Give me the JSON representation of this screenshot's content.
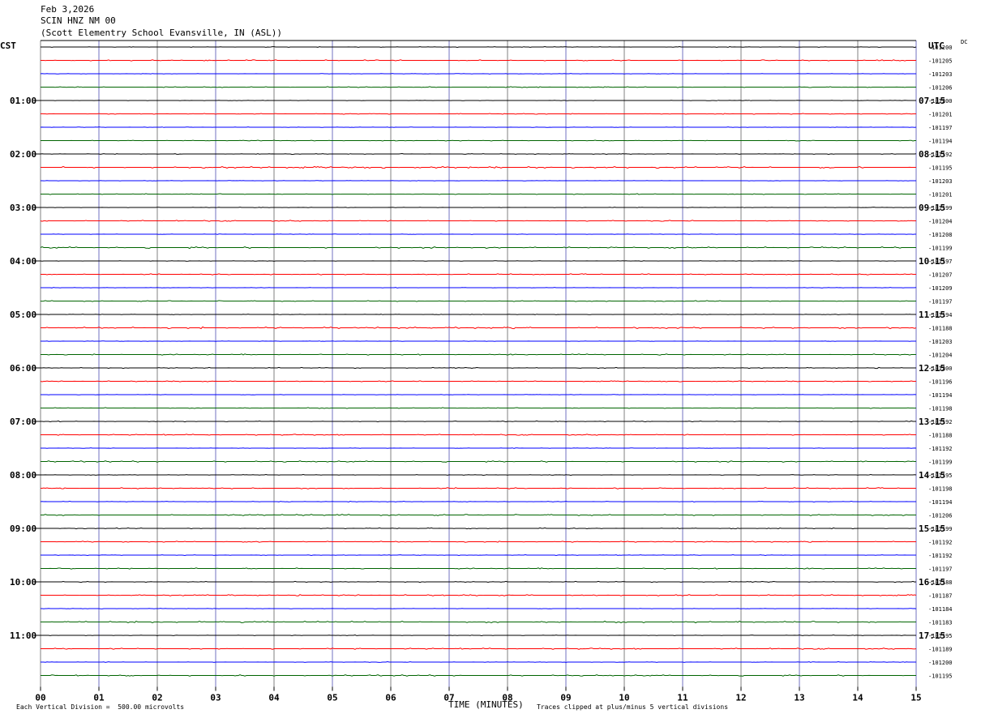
{
  "header": {
    "date": "Feb 3,2026",
    "station": "SCIN HNZ NM 00",
    "location": "(Scott Elementry School Evansville, IN (ASL))"
  },
  "left_zone": "CST",
  "right_zone": "UTC",
  "dc_label": "DC",
  "footer": {
    "left": "Each Vertical Division =  500.00 microvolts",
    "xlabel": "TIME (MINUTES)",
    "right": "Traces clipped at plus/minus 5 vertical divisions"
  },
  "colors": {
    "black": "#000000",
    "red": "#ff0000",
    "blue": "#0000ff",
    "green": "#006400",
    "grid": "#808080"
  },
  "chart_data": {
    "type": "line",
    "title": "",
    "xlabel": "TIME (MINUTES)",
    "x_ticks": [
      "00",
      "01",
      "02",
      "03",
      "04",
      "05",
      "06",
      "07",
      "08",
      "09",
      "10",
      "11",
      "12",
      "13",
      "14",
      "15"
    ],
    "xlim": [
      0,
      15
    ],
    "traces_per_hour": 4,
    "trace_color_cycle": [
      "black",
      "red",
      "blue",
      "green"
    ],
    "left_time_labels": [
      "01:00",
      "02:00",
      "03:00",
      "04:00",
      "05:00",
      "06:00",
      "07:00",
      "08:00",
      "09:00",
      "10:00",
      "11:00"
    ],
    "right_time_labels": [
      "07:15",
      "08:15",
      "09:15",
      "10:15",
      "11:15",
      "12:15",
      "13:15",
      "14:15",
      "15:15",
      "16:15",
      "17:15"
    ],
    "dc_offsets": [
      "-101200",
      "-101205",
      "-101203",
      "-101206",
      "-101200",
      "-101201",
      "-101197",
      "-101194",
      "-101192",
      "-101195",
      "-101203",
      "-101201",
      "-101199",
      "-101204",
      "-101208",
      "-101199",
      "-101197",
      "-101207",
      "-101209",
      "-101197",
      "-101194",
      "-101188",
      "-101203",
      "-101204",
      "-101200",
      "-101196",
      "-101194",
      "-101198",
      "-101192",
      "-101188",
      "-101192",
      "-101199",
      "-101195",
      "-101198",
      "-101194",
      "-101206",
      "-101199",
      "-101192",
      "-101192",
      "-101197",
      "-101188",
      "-101187",
      "-101184",
      "-101183",
      "-101195",
      "-101189",
      "-101200",
      "-101195"
    ],
    "amplitude_levels": [
      0.4,
      0.6,
      0.3,
      0.5,
      0.3,
      0.5,
      0.3,
      0.4,
      0.4,
      0.9,
      0.3,
      0.5,
      0.3,
      0.6,
      0.3,
      0.9,
      0.3,
      0.6,
      0.3,
      0.5,
      0.3,
      0.9,
      0.3,
      0.6,
      0.5,
      0.5,
      0.3,
      0.5,
      0.5,
      0.6,
      0.3,
      0.7,
      0.4,
      0.7,
      0.4,
      0.7,
      0.5,
      0.6,
      0.4,
      0.6,
      0.5,
      0.7,
      0.3,
      0.9,
      0.4,
      0.7,
      0.4,
      0.7
    ]
  }
}
